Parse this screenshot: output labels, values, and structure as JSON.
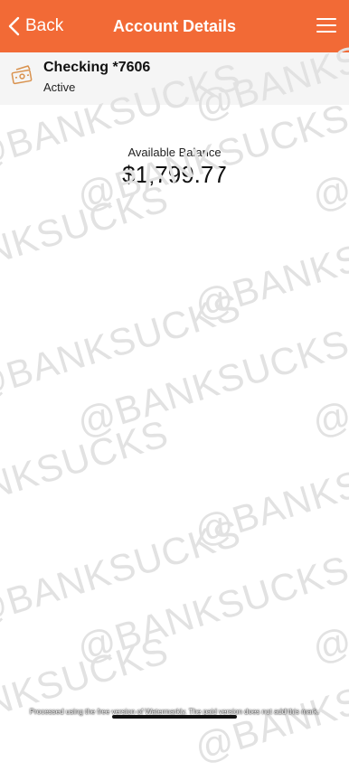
{
  "nav": {
    "back_label": "Back",
    "title": "Account Details",
    "bg_color": "#f26a36",
    "back_icon": "chevron-left-icon",
    "menu_icon": "hamburger-menu-icon"
  },
  "account": {
    "name": "Checking *7606",
    "status": "Active",
    "icon": "money-bill-icon",
    "accent_color": "#d9924e"
  },
  "balance": {
    "label": "Available Balance",
    "value": "$1,799.77"
  },
  "watermark": {
    "text": "@BANKSUCKS"
  },
  "footer": {
    "caption": "Processed using the free version of Watermarkly. The paid version does not add this mark."
  }
}
